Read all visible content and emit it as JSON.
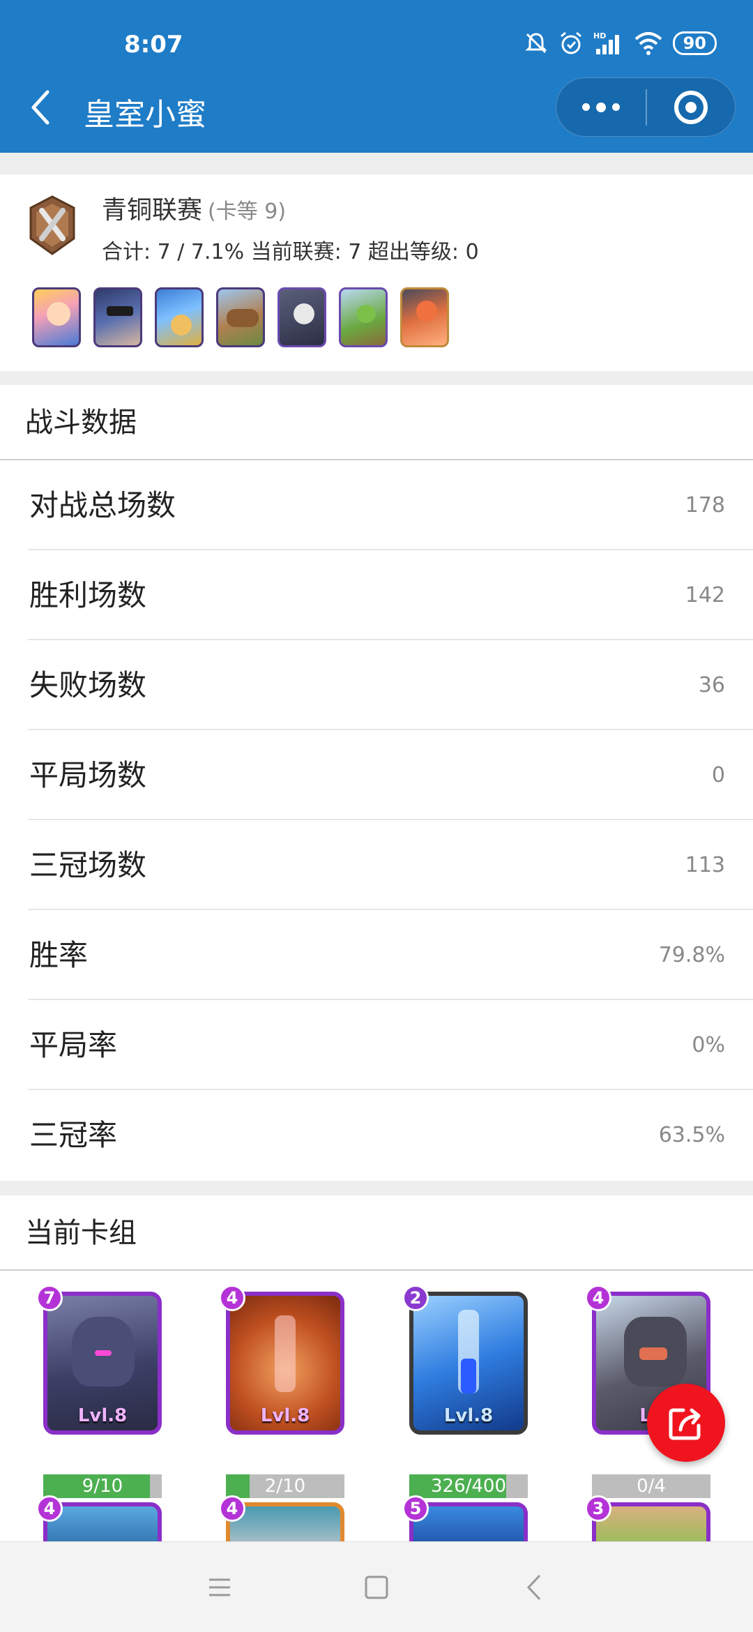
{
  "status_bar": {
    "time": "8:07",
    "battery": "90",
    "icons": [
      "mute-icon",
      "alarm-icon",
      "hd-signal-icon",
      "wifi-icon",
      "battery-icon"
    ]
  },
  "header": {
    "title": "皇室小蜜",
    "back_icon": "chevron-left-icon",
    "capsule": [
      "more-dots-icon",
      "close-target-icon"
    ]
  },
  "player": {
    "league": "青铜联赛",
    "league_note": "(卡等 9)",
    "summary": "合计: 7 / 7.1% 当前联赛: 7 超出等级: 0",
    "favorite_cards": [
      "princess",
      "bandit",
      "royal-delivery",
      "ram",
      "skeleton",
      "goblin",
      "valkyrie"
    ]
  },
  "battle": {
    "title": "战斗数据",
    "rows": [
      {
        "label": "对战总场数",
        "value": "178"
      },
      {
        "label": "胜利场数",
        "value": "142"
      },
      {
        "label": "失败场数",
        "value": "36"
      },
      {
        "label": "平局场数",
        "value": "0"
      },
      {
        "label": "三冠场数",
        "value": "113"
      },
      {
        "label": "胜率",
        "value": "79.8%"
      },
      {
        "label": "平局率",
        "value": "0%"
      },
      {
        "label": "三冠率",
        "value": "63.5%"
      }
    ]
  },
  "deck": {
    "title": "当前卡组",
    "cards": [
      {
        "elixir": "7",
        "level": "Lvl.8",
        "progress": "9/10",
        "progress_fraction": 0.9
      },
      {
        "elixir": "4",
        "level": "Lvl.8",
        "progress": "2/10",
        "progress_fraction": 0.2
      },
      {
        "elixir": "2",
        "level": "Lvl.8",
        "progress": "326/400",
        "progress_fraction": 0.815
      },
      {
        "elixir": "4",
        "level": "Lv",
        "progress": "0/4",
        "progress_fraction": 0
      }
    ],
    "second_row_elixir": [
      "4",
      "4",
      "5",
      "3"
    ]
  },
  "colors": {
    "header": "#1f7cc7",
    "fab": "#f0141e",
    "progress_fill": "#4caf50"
  }
}
